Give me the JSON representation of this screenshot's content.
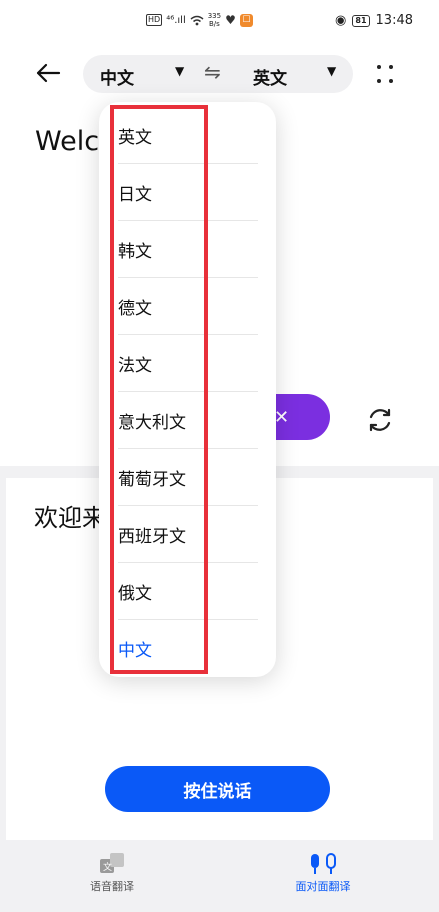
{
  "status_bar": {
    "hd": "HD",
    "signal": "⁴⁶.ıll",
    "speed_value": "335",
    "speed_unit": "B/s",
    "battery": "81",
    "time": "13:48"
  },
  "header": {
    "source_lang": "中文",
    "target_lang": "英文",
    "swap_icon": "⇋"
  },
  "source_text": "Welc          ing.",
  "target_text": "欢迎来",
  "talk_button": "按住说话",
  "bottom_nav": [
    {
      "label": "语音翻译",
      "icon": "voice-translate-icon",
      "active": false
    },
    {
      "label": "面对面翻译",
      "icon": "face-to-face-icon",
      "active": true
    }
  ],
  "dropdown": {
    "items": [
      {
        "label": "英文",
        "selected": false
      },
      {
        "label": "日文",
        "selected": false
      },
      {
        "label": "韩文",
        "selected": false
      },
      {
        "label": "德文",
        "selected": false
      },
      {
        "label": "法文",
        "selected": false
      },
      {
        "label": "意大利文",
        "selected": false
      },
      {
        "label": "葡萄牙文",
        "selected": false
      },
      {
        "label": "西班牙文",
        "selected": false
      },
      {
        "label": "俄文",
        "selected": false
      },
      {
        "label": "中文",
        "selected": true
      }
    ]
  },
  "colors": {
    "accent": "#0a59f7",
    "purple": "#7b2fe0",
    "highlight": "#e8303a"
  }
}
